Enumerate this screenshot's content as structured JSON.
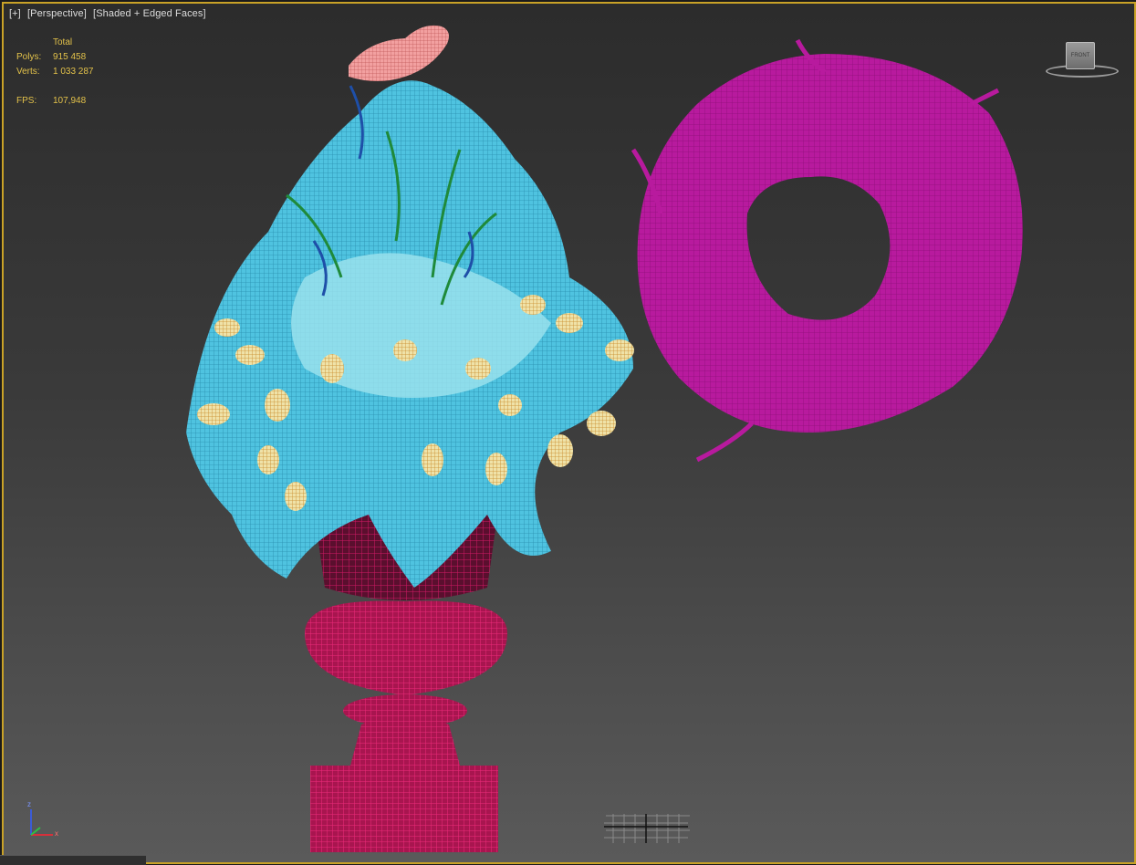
{
  "viewport": {
    "label_parts": [
      "[+]",
      "[Perspective]",
      "[Shaded + Edged Faces]"
    ],
    "stats": {
      "header": "Total",
      "polys_label": "Polys:",
      "polys_value": "915 458",
      "verts_label": "Verts:",
      "verts_value": "1 033 287",
      "fps_label": "FPS:",
      "fps_value": "107,948"
    },
    "viewcube_face": "FRONT",
    "axis": {
      "z": "z",
      "x": "x"
    }
  },
  "colors": {
    "border": "#c9a227",
    "stats_text": "#e3c24a",
    "vase": "#c2185b",
    "foliage": "#4fc3e0",
    "foliage_light": "#a6e6ef",
    "tulip": "#e8d9a0",
    "stems": "#1f8a3a",
    "wreath": "#b81a9e",
    "bird": "#e48a8a"
  }
}
